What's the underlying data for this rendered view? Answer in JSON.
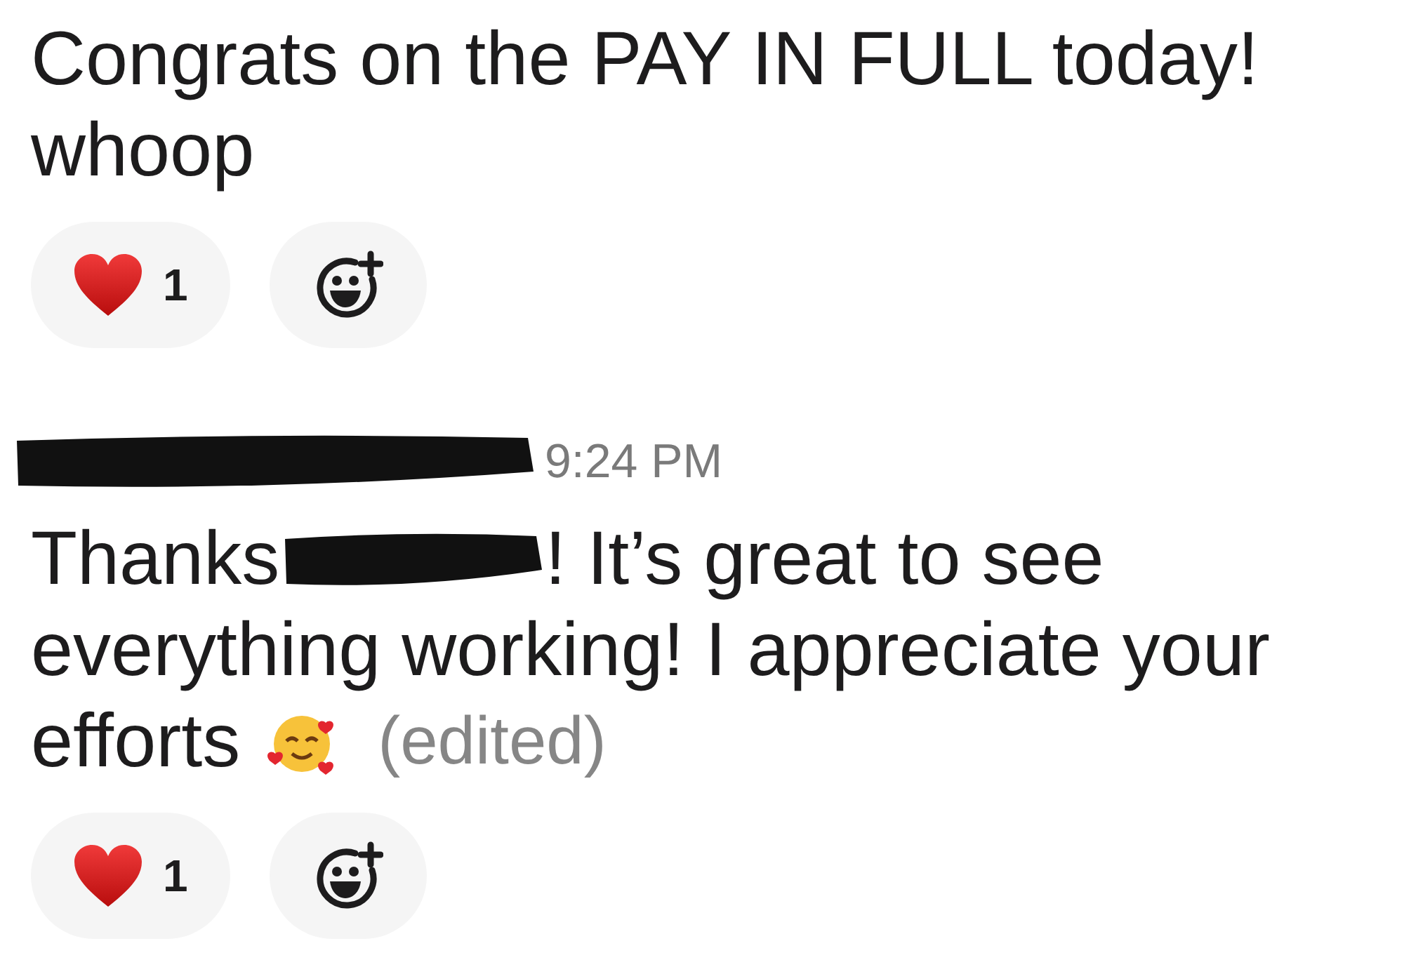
{
  "messages": [
    {
      "author_redacted": false,
      "text": "Congrats on the PAY IN FULL today!\nwhoop",
      "reactions": [
        {
          "kind": "heart",
          "count": "1",
          "selected": false
        }
      ]
    },
    {
      "author_redacted": true,
      "time": "9:24 PM",
      "lines": [
        [
          {
            "kind": "text",
            "text": "Thanks"
          },
          {
            "kind": "redaction"
          },
          {
            "kind": "text",
            "text": "! It’s great to see"
          }
        ],
        [
          {
            "kind": "text",
            "text": "everything working! I appreciate your"
          }
        ],
        [
          {
            "kind": "text",
            "text": "efforts"
          },
          {
            "kind": "emoji"
          },
          {
            "kind": "edited",
            "text": "(edited)"
          }
        ]
      ],
      "reactions": [
        {
          "kind": "heart",
          "count": "1",
          "selected": false
        }
      ]
    }
  ]
}
